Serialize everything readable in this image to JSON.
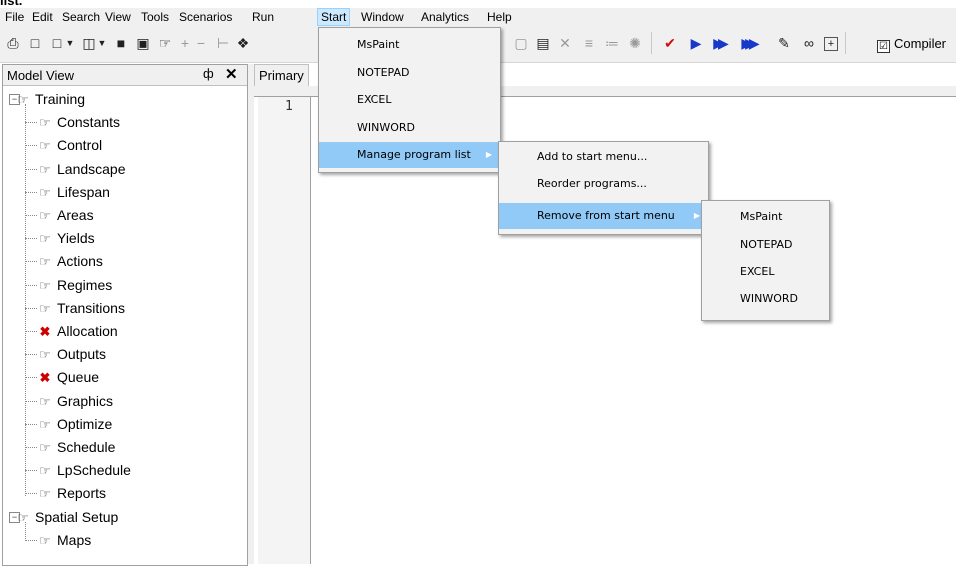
{
  "top_fragment": "list.",
  "menubar": [
    "File",
    "Edit",
    "Search",
    "View",
    "Tools",
    "Scenarios",
    "Run",
    "Start",
    "Window",
    "Analytics",
    "Help"
  ],
  "toolbar": {
    "compile_label": "Compiler",
    "compile_checked": "☑"
  },
  "model_view": {
    "title": "Model View",
    "pin_glyph": "1",
    "close_glyph": "✕",
    "tree": [
      {
        "label": "Training",
        "level": 0,
        "expander": "−",
        "icon": "node-icon"
      },
      {
        "label": "Constants",
        "level": 1,
        "icon": "node-icon"
      },
      {
        "label": "Control",
        "level": 1,
        "icon": "node-icon"
      },
      {
        "label": "Landscape",
        "level": 1,
        "icon": "node-icon"
      },
      {
        "label": "Lifespan",
        "level": 1,
        "icon": "node-icon"
      },
      {
        "label": "Areas",
        "level": 1,
        "icon": "node-icon"
      },
      {
        "label": "Yields",
        "level": 1,
        "icon": "node-icon"
      },
      {
        "label": "Actions",
        "level": 1,
        "icon": "node-icon"
      },
      {
        "label": "Regimes",
        "level": 1,
        "icon": "node-icon"
      },
      {
        "label": "Transitions",
        "level": 1,
        "icon": "node-icon"
      },
      {
        "label": "Allocation",
        "level": 1,
        "icon": "error-node-icon"
      },
      {
        "label": "Outputs",
        "level": 1,
        "icon": "node-icon"
      },
      {
        "label": "Queue",
        "level": 1,
        "icon": "error-node-icon"
      },
      {
        "label": "Graphics",
        "level": 1,
        "icon": "node-icon"
      },
      {
        "label": "Optimize",
        "level": 1,
        "icon": "node-icon"
      },
      {
        "label": "Schedule",
        "level": 1,
        "icon": "node-icon"
      },
      {
        "label": "LpSchedule",
        "level": 1,
        "icon": "node-icon"
      },
      {
        "label": "Reports",
        "level": 1,
        "icon": "node-icon"
      },
      {
        "label": "Spatial Setup",
        "level": 0,
        "expander": "−",
        "icon": "node-icon"
      },
      {
        "label": "Maps",
        "level": 1,
        "icon": "node-icon"
      }
    ]
  },
  "editor": {
    "tab_label": "Primary",
    "line_numbers": [
      "1"
    ]
  },
  "start_menu": {
    "items": [
      "MsPaint",
      "NOTEPAD",
      "EXCEL",
      "WINWORD",
      "Manage program list"
    ]
  },
  "manage_menu": {
    "items": [
      "Add to start menu...",
      "Reorder programs...",
      "Remove from start menu"
    ]
  },
  "remove_menu": {
    "items": [
      "MsPaint",
      "NOTEPAD",
      "EXCEL",
      "WINWORD"
    ]
  },
  "colors": {
    "menu_highlight": "#91c9f7",
    "active_menu_bg": "#cce8ff",
    "error_icon": "#cc0000",
    "run_icons": "#1838c8"
  }
}
